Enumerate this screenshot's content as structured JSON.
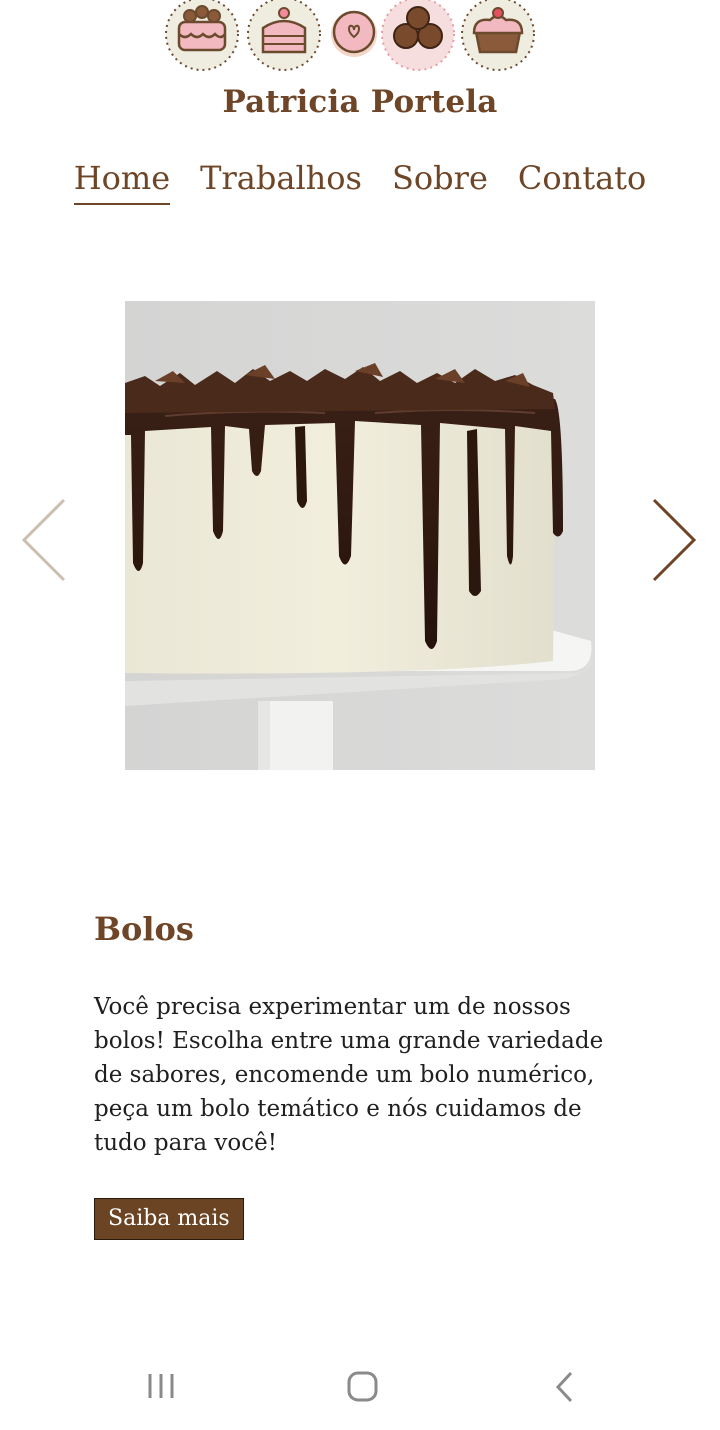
{
  "header": {
    "brand_name": "Patricia Portela",
    "logo_icons": [
      "cake-icon",
      "cake-slice-icon",
      "donut-icon",
      "cookies-icon",
      "cupcake-icon"
    ]
  },
  "nav": {
    "items": [
      {
        "label": "Home",
        "active": true
      },
      {
        "label": "Trabalhos",
        "active": false
      },
      {
        "label": "Sobre",
        "active": false
      },
      {
        "label": "Contato",
        "active": false
      }
    ]
  },
  "carousel": {
    "current_slide": "chocolate-drip-cake-photo",
    "prev_icon": "chevron-left-icon",
    "next_icon": "chevron-right-icon"
  },
  "section": {
    "title": "Bolos",
    "body": "Você precisa experimentar um de nossos bolos! Escolha entre uma grande variedade de sabores, encomende um bolo numérico, peça um bolo temático e nós cuidamos de tudo para você!",
    "button_label": "Saiba mais"
  },
  "system_nav": {
    "icons": [
      "recent-apps-icon",
      "home-icon",
      "back-icon"
    ]
  },
  "colors": {
    "brand_brown": "#6e4526",
    "button_bg": "#6b4423",
    "icon_bg": "#efece0",
    "icon_pink": "#f2b9c0",
    "arrow_light": "#cbbfb2"
  }
}
